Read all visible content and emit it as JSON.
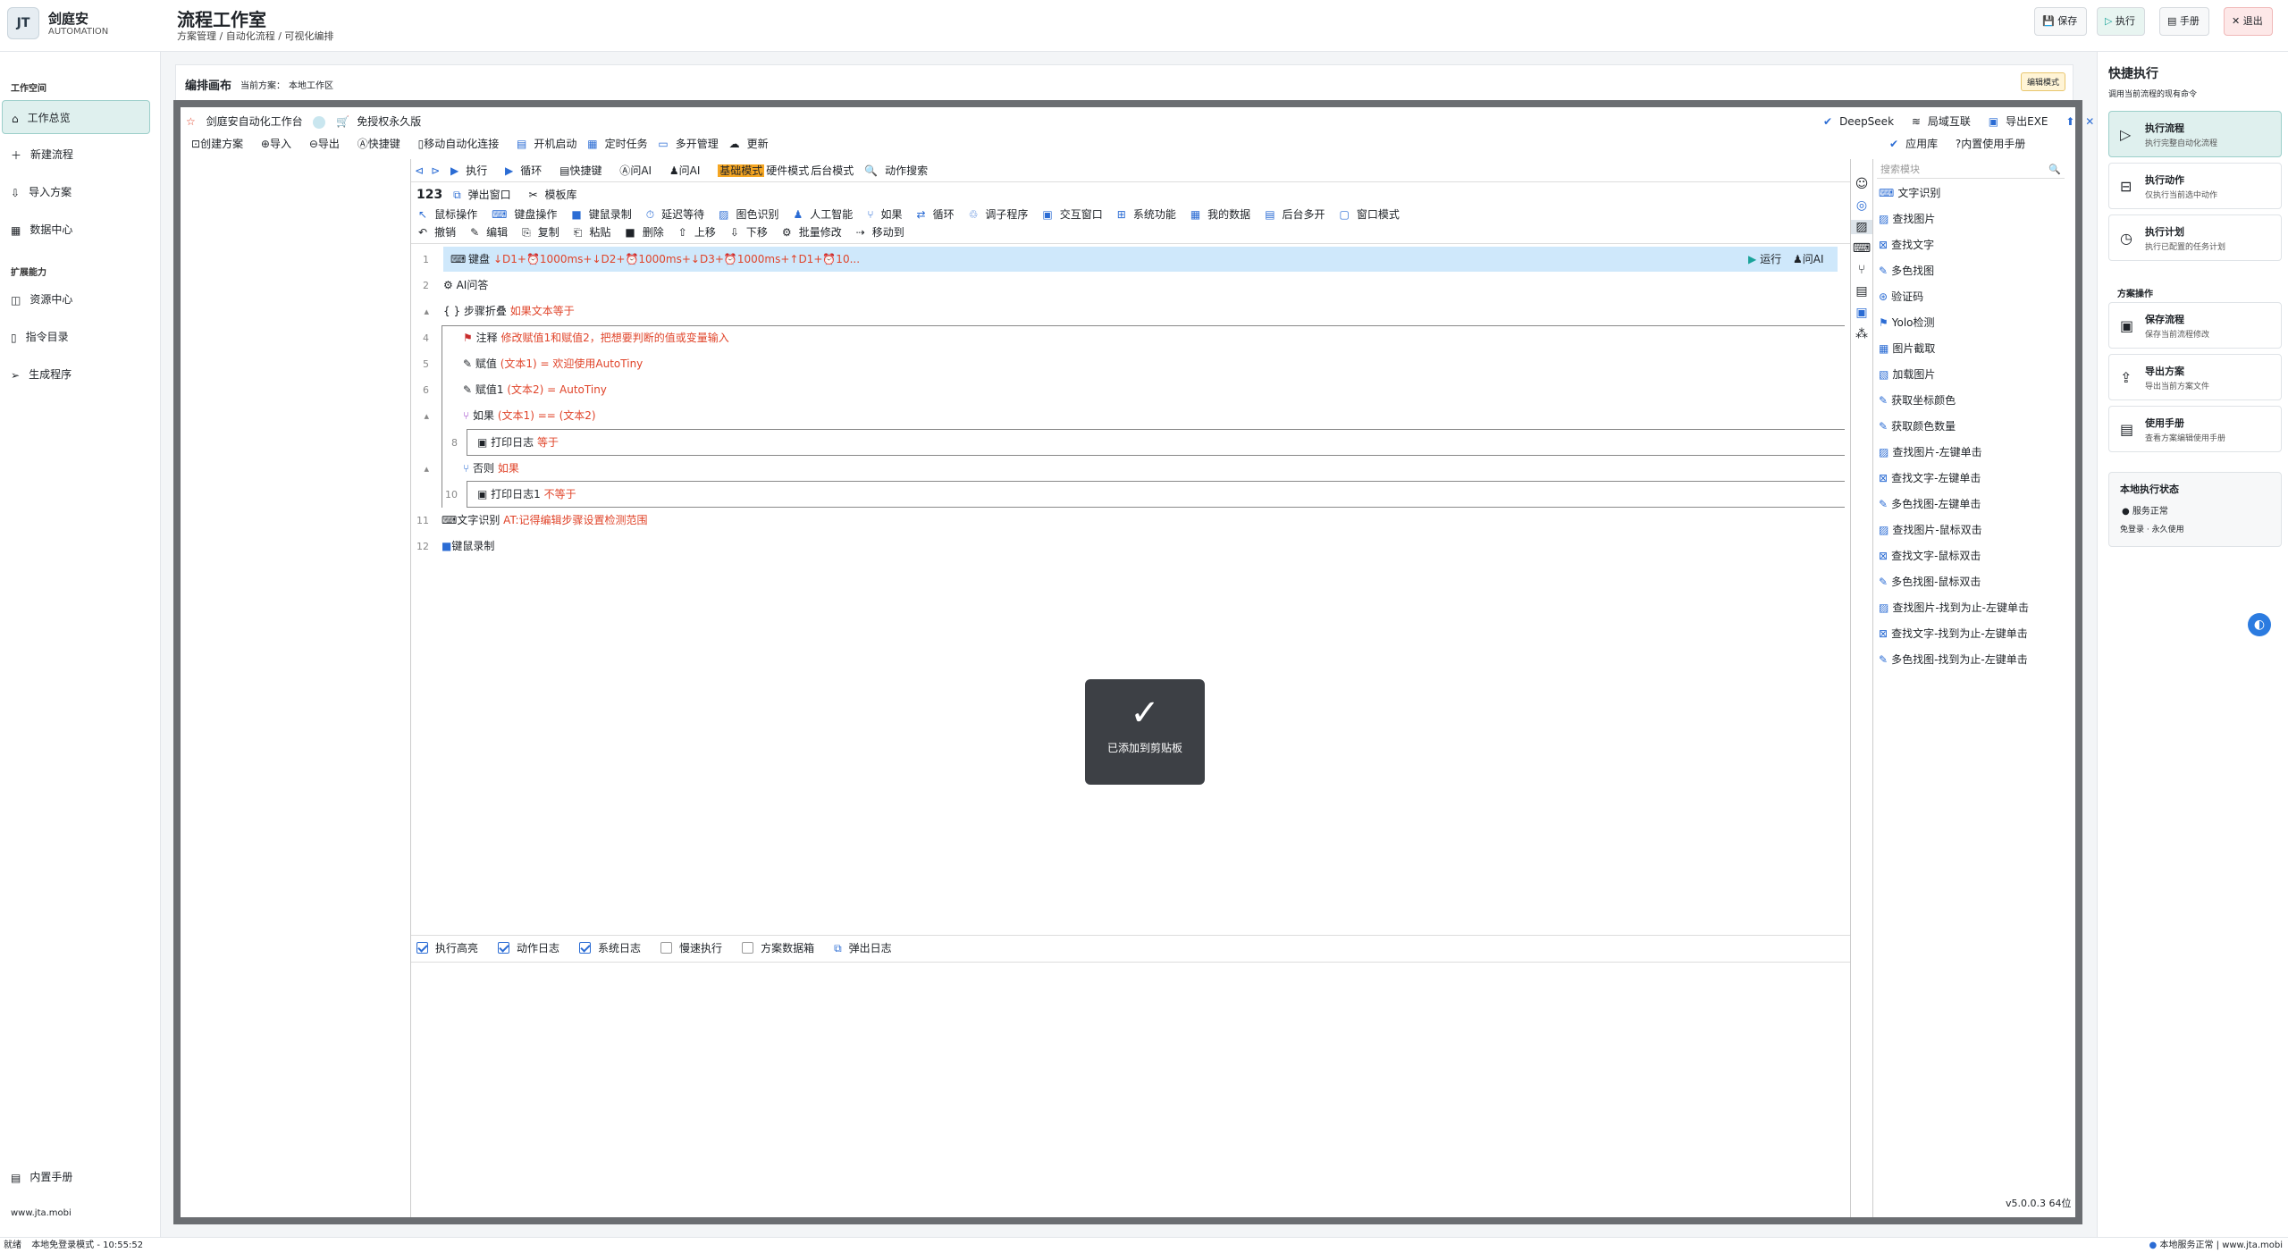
{
  "header": {
    "brand": "剑庭安",
    "brand_sub": "AUTOMATION",
    "logo": "JT",
    "title": "流程工作室",
    "breadcrumb": "方案管理 / 自动化流程 / 可视化编排",
    "buttons": {
      "save": "保存",
      "run": "执行",
      "manual": "手册",
      "exit": "退出"
    }
  },
  "sidebar": {
    "section1": "工作空间",
    "items1": [
      "工作总览",
      "新建流程",
      "导入方案",
      "数据中心"
    ],
    "section2": "扩展能力",
    "items2": [
      "资源中心",
      "指令目录",
      "生成程序"
    ],
    "manual": "内置手册",
    "site": "www.jta.mobi"
  },
  "canvas": {
    "title": "编排画布",
    "plan_label": "当前方案：",
    "plan": "本地工作区",
    "mode_badge": "编辑模式"
  },
  "app": {
    "title": "剑庭安自动化工作台",
    "license": "免授权永久版",
    "deepseek": "DeepSeek",
    "lan": "局域互联",
    "export_exe": "导出EXE"
  },
  "menu": [
    "创建方案",
    "导入",
    "导出",
    "快捷键",
    "移动自动化连接",
    "开机启动",
    "定时任务",
    "多开管理",
    "更新"
  ],
  "menu_right": [
    "应用库",
    "内置使用手册"
  ],
  "toolbar1": {
    "run": "执行",
    "loop": "循环",
    "hotkey": "快捷键",
    "ask_ai": "问AI",
    "mode_basic": "基础模式",
    "mode_hw": "硬件模式",
    "mode_bg": "后台模式",
    "search": "动作搜索"
  },
  "toolbar2": {
    "num": "123",
    "popup": "弹出窗口",
    "templates": "模板库"
  },
  "toolbar3": [
    "鼠标操作",
    "键盘操作",
    "键鼠录制",
    "延迟等待",
    "图色识别",
    "人工智能",
    "如果",
    "循环",
    "调子程序",
    "交互窗口",
    "系统功能",
    "我的数据",
    "后台多开",
    "窗口模式"
  ],
  "toolbar4": [
    "撤销",
    "编辑",
    "复制",
    "粘贴",
    "删除",
    "上移",
    "下移",
    "批量修改",
    "移动到"
  ],
  "code": [
    {
      "n": "1",
      "name": "键盘",
      "arg": "↓D1+⏰1000ms+↓D2+⏰1000ms+↓D3+⏰1000ms+↑D1+⏰10...",
      "run": "运行",
      "ask": "问AI"
    },
    {
      "n": "2",
      "name": "AI问答",
      "arg": ""
    },
    {
      "n": "3",
      "name": "{ } 步骤折叠",
      "arg": "如果文本等于"
    },
    {
      "n": "4",
      "name": "注释",
      "arg": "修改赋值1和赋值2，把想要判断的值或变量输入"
    },
    {
      "n": "5",
      "name": "赋值",
      "arg": "(文本1) = 欢迎使用AutoTiny"
    },
    {
      "n": "6",
      "name": "赋值1",
      "arg": "(文本2) = AutoTiny"
    },
    {
      "n": "7",
      "name": "如果",
      "arg": "(文本1) == (文本2)"
    },
    {
      "n": "8",
      "name": "打印日志",
      "arg": "等于"
    },
    {
      "n": "9",
      "name": "否则",
      "arg": "如果"
    },
    {
      "n": "10",
      "name": "打印日志1",
      "arg": "不等于"
    },
    {
      "n": "11",
      "name": "文字识别",
      "arg": "AT:记得编辑步骤设置检测范围"
    },
    {
      "n": "12",
      "name": "键鼠录制",
      "arg": ""
    }
  ],
  "toast": "已添加到剪贴板",
  "log_opts": [
    {
      "label": "执行高亮",
      "on": true
    },
    {
      "label": "动作日志",
      "on": true
    },
    {
      "label": "系统日志",
      "on": true
    },
    {
      "label": "慢速执行",
      "on": false
    },
    {
      "label": "方案数据箱",
      "on": false
    }
  ],
  "log_popup": "弹出日志",
  "search_placeholder": "搜索模块",
  "modules": [
    "文字识别",
    "查找图片",
    "查找文字",
    "多色找图",
    "验证码",
    "Yolo检测",
    "图片截取",
    "加载图片",
    "获取坐标颜色",
    "获取颜色数量",
    "查找图片-左键单击",
    "查找文字-左键单击",
    "多色找图-左键单击",
    "查找图片-鼠标双击",
    "查找文字-鼠标双击",
    "多色找图-鼠标双击",
    "查找图片-找到为止-左键单击",
    "查找文字-找到为止-左键单击",
    "多色找图-找到为止-左键单击"
  ],
  "version": "v5.0.0.3 64位",
  "quick": {
    "title": "快捷执行",
    "sub": "调用当前流程的现有命令",
    "cards": [
      {
        "t": "执行流程",
        "d": "执行完整自动化流程"
      },
      {
        "t": "执行动作",
        "d": "仅执行当前选中动作"
      },
      {
        "t": "执行计划",
        "d": "执行已配置的任务计划"
      }
    ],
    "section": "方案操作",
    "cards2": [
      {
        "t": "保存流程",
        "d": "保存当前流程修改"
      },
      {
        "t": "导出方案",
        "d": "导出当前方案文件"
      },
      {
        "t": "使用手册",
        "d": "查看方案编辑使用手册"
      }
    ],
    "status_title": "本地执行状态",
    "status_ok": "服务正常",
    "status_info": "免登录 · 永久使用"
  },
  "statusbar": {
    "left": "就绪",
    "mode": "本地免登录模式",
    "time": "10:55:52",
    "right_status": "本地服务正常",
    "right_site": "www.jta.mobi"
  },
  "colors": {
    "accent": "#1aa39a",
    "active_bg": "#dff0ee",
    "selected_row": "#cfe8fb",
    "red_arg": "#e0442a",
    "exit_bg": "#fde8e8"
  }
}
